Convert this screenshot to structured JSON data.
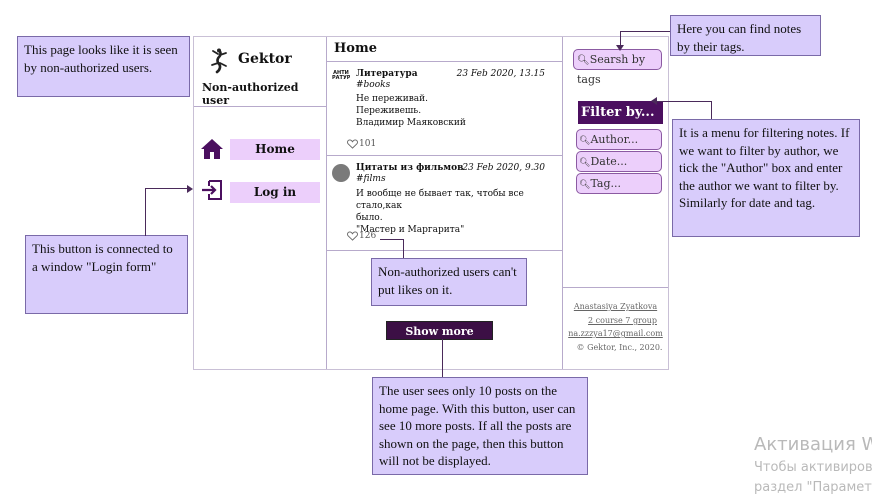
{
  "notes": {
    "non_authorized": "This page looks like it is seen by non-authorized users.",
    "login_button": "This button  is connected to a window \"Login form\"",
    "search_tags": "Here you can find notes by their tags.",
    "filter_menu": "It is a menu for filtering notes. If we want to filter by author, we tick the \"Author\" box and enter the author we want to filter by. Similarly for date and tag.",
    "likes": "Non-authorized users can't put likes on it.",
    "show_more": "The user sees only 10 posts on the home page. With this button, user can see 10 more posts. If all the posts are shown on the page, then this button will not be displayed."
  },
  "brand": {
    "name": "Gektor",
    "subtitle": "Non-authorized user",
    "logo_icon": "gecko-icon"
  },
  "nav": [
    {
      "label": "Home",
      "icon": "home-icon"
    },
    {
      "label": "Log in",
      "icon": "login-icon"
    }
  ],
  "main": {
    "title": "Home",
    "posts": [
      {
        "author": "Литература",
        "date": "23 Feb 2020, 13.15",
        "tag": "#books",
        "lines": [
          "Не переживай.",
          "Переживешь.",
          "Владимир Маяковский"
        ],
        "likes": "101",
        "avatar_text": "АНТИ РАТУРА"
      },
      {
        "author": "Цитаты из фильмов",
        "date": "23 Feb 2020, 9.30",
        "tag": "#films",
        "lines": [
          "И вообще не бывает так, чтобы все стало,как",
          "было.",
          "\"Мастер и Маргарита\""
        ],
        "likes": "126"
      }
    ],
    "show_more": "Show more"
  },
  "sidebar": {
    "search_tags": "Searsh by tags",
    "filter_title": "Filter by...",
    "filters": [
      "Author...",
      "Date...",
      "Tag..."
    ],
    "footer": {
      "name": "Anastasiya Zyatkova",
      "group": "2 course 7 group",
      "email": "na.zzzya17@gmail.com",
      "copyright": "© Gektor, Inc., 2020."
    }
  },
  "watermark": {
    "line1": "Активация W",
    "line2": "Чтобы активиров",
    "line3": "раздел \"Парамет"
  },
  "colors": {
    "note_bg": "#d8ccfb",
    "accent_dark": "#4b0f5f",
    "button_light": "#eccffb"
  }
}
